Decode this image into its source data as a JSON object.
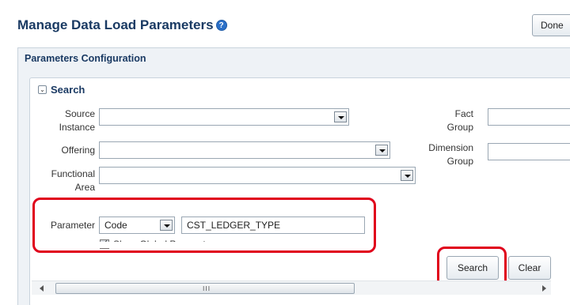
{
  "header": {
    "title": "Manage Data Load Parameters",
    "help_icon": "?",
    "done_label": "Done"
  },
  "config": {
    "title": "Parameters Configuration"
  },
  "search": {
    "title": "Search",
    "toggle_icon": "⌄",
    "source_instance_label": "Source Instance",
    "source_instance_value": "",
    "offering_label": "Offering",
    "offering_value": "",
    "functional_area_label": "Functional Area",
    "functional_area_value": "",
    "fact_group_label": "Fact Group",
    "fact_group_value": "",
    "dimension_group_label": "Dimension Group",
    "dimension_group_value": "",
    "parameter_label": "Parameter",
    "parameter_type_value": "Code",
    "parameter_value": "CST_LEDGER_TYPE",
    "show_global_label": "Show Global Parameters",
    "search_button": "Search",
    "clear_button": "Clear",
    "scroll_grip": "III"
  },
  "colors": {
    "highlight": "#e0001b",
    "title": "#1a3a63"
  }
}
